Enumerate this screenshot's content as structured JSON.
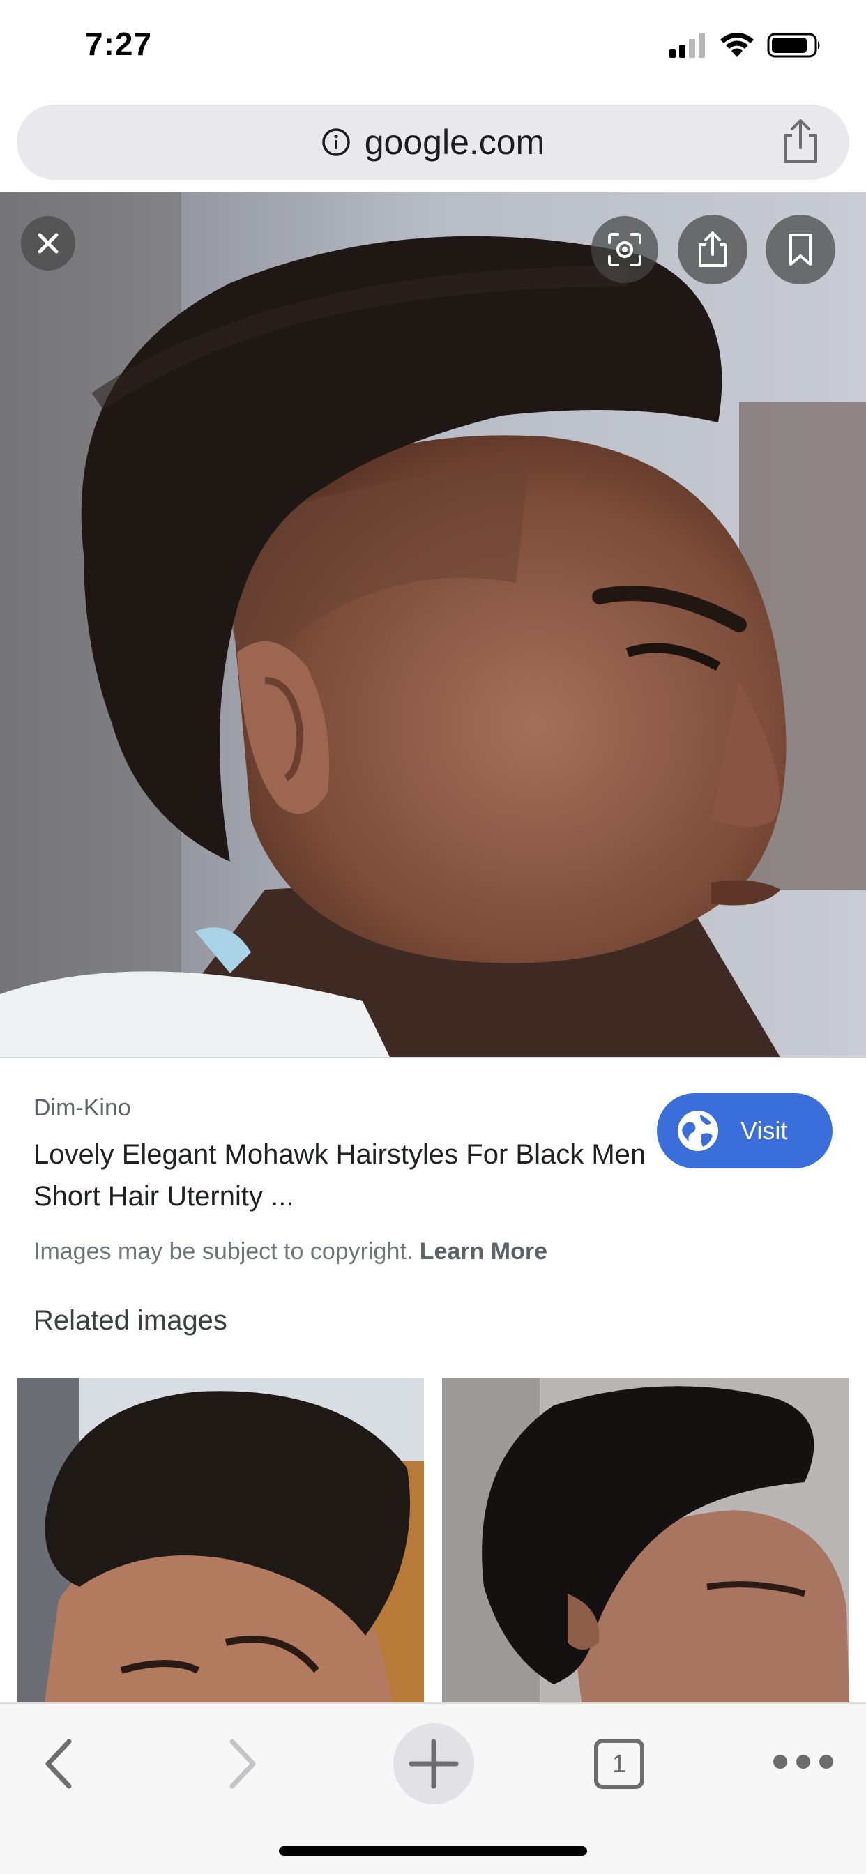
{
  "status_bar": {
    "time": "7:27"
  },
  "url_bar": {
    "domain": "google.com"
  },
  "image_viewer": {
    "close_icon": "close-icon",
    "lens_icon": "lens-icon",
    "share_icon": "share-icon",
    "save_icon": "bookmark-icon"
  },
  "result": {
    "source": "Dim-Kino",
    "title": "Lovely Elegant Mohawk Hairstyles For Black Men Short Hair Uternity ...",
    "visit_label": "Visit",
    "copyright_text": "Images may be subject to copyright.",
    "learn_more": "Learn More"
  },
  "related": {
    "heading": "Related images"
  },
  "toolbar": {
    "tab_count": "1"
  },
  "colors": {
    "accent": "#3a6fdb",
    "url_bar_bg": "#e8e8ed",
    "toolbar_bg": "#f7f7f7"
  }
}
